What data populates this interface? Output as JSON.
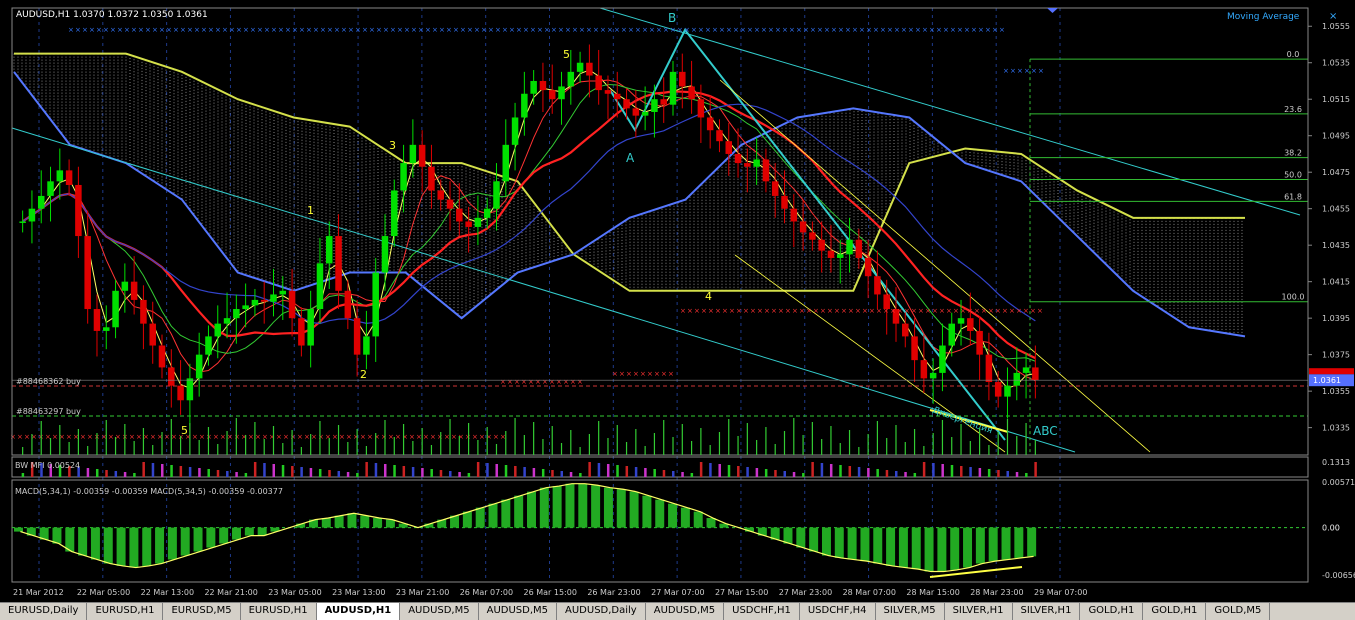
{
  "window": {
    "symbol_header": "AUDUSD,H1  1.0370 1.0372 1.0350 1.0361",
    "indicator_label": "Moving Average",
    "close_glyph": "×"
  },
  "colors": {
    "background": "#000000",
    "grid": "#1e3a8a",
    "bull": "#00e000",
    "bear": "#e00000",
    "cloud_top": "#d4e04a",
    "cloud_bottom": "#5577ff",
    "channel": "#33cccc",
    "price_marker": "#5570ff",
    "fib": "#33bb33"
  },
  "chart_data": {
    "type": "candlestick",
    "title": "AUDUSD,H1",
    "ohlc_header": {
      "open": 1.037,
      "high": 1.0372,
      "low": 1.035,
      "close": 1.0361
    },
    "ylim": [
      1.032,
      1.0565
    ],
    "y_ticks": [
      "1.0555",
      "1.0535",
      "1.0515",
      "1.0495",
      "1.0475",
      "1.0455",
      "1.0435",
      "1.0415",
      "1.0395",
      "1.0375",
      "1.0355",
      "1.0335"
    ],
    "current_price": "1.0361",
    "x_ticks": [
      "21 Mar 2012",
      "22 Mar 05:00",
      "22 Mar 13:00",
      "22 Mar 21:00",
      "23 Mar 05:00",
      "23 Mar 13:00",
      "23 Mar 21:00",
      "26 Mar 07:00",
      "26 Mar 15:00",
      "26 Mar 23:00",
      "27 Mar 07:00",
      "27 Mar 15:00",
      "27 Mar 23:00",
      "28 Mar 07:00",
      "28 Mar 15:00",
      "28 Mar 23:00",
      "29 Mar 07:00"
    ],
    "close_path": [
      1.0448,
      1.0455,
      1.0462,
      1.047,
      1.0476,
      1.0468,
      1.044,
      1.04,
      1.0388,
      1.039,
      1.041,
      1.0415,
      1.0405,
      1.0392,
      1.038,
      1.0368,
      1.0358,
      1.035,
      1.0362,
      1.0375,
      1.0385,
      1.0392,
      1.0395,
      1.04,
      1.0402,
      1.0405,
      1.0404,
      1.0408,
      1.041,
      1.0395,
      1.038,
      1.04,
      1.0425,
      1.044,
      1.041,
      1.0395,
      1.0375,
      1.0385,
      1.042,
      1.044,
      1.0465,
      1.048,
      1.049,
      1.0478,
      1.0465,
      1.046,
      1.0455,
      1.0448,
      1.0445,
      1.045,
      1.0455,
      1.047,
      1.049,
      1.0505,
      1.0518,
      1.0525,
      1.052,
      1.0515,
      1.0522,
      1.053,
      1.0535,
      1.0528,
      1.052,
      1.0518,
      1.0515,
      1.051,
      1.0506,
      1.0508,
      1.0515,
      1.0512,
      1.053,
      1.0522,
      1.0515,
      1.0505,
      1.0498,
      1.0492,
      1.0485,
      1.048,
      1.0478,
      1.0482,
      1.047,
      1.0462,
      1.0455,
      1.0448,
      1.0442,
      1.0438,
      1.0432,
      1.0428,
      1.043,
      1.0438,
      1.0428,
      1.0418,
      1.0408,
      1.04,
      1.0392,
      1.0385,
      1.0372,
      1.0362,
      1.0365,
      1.038,
      1.0392,
      1.0395,
      1.0388,
      1.0375,
      1.036,
      1.0352,
      1.0358,
      1.0365,
      1.0368,
      1.0361
    ],
    "ichimoku_span_a": [
      1.054,
      1.054,
      1.054,
      1.053,
      1.0515,
      1.0505,
      1.05,
      1.048,
      1.048,
      1.047,
      1.043,
      1.041,
      1.041,
      1.041,
      1.041,
      1.041,
      1.048,
      1.0488,
      1.0485,
      1.0465,
      1.045,
      1.045,
      1.045
    ],
    "ichimoku_span_b": [
      1.053,
      1.049,
      1.048,
      1.046,
      1.042,
      1.041,
      1.042,
      1.042,
      1.0395,
      1.042,
      1.043,
      1.045,
      1.046,
      1.049,
      1.0505,
      1.051,
      1.0505,
      1.048,
      1.047,
      1.044,
      1.041,
      1.039,
      1.0385
    ],
    "annotations": [
      {
        "text": "B",
        "color": "#33cccc"
      },
      {
        "text": "A",
        "color": "#33cccc"
      },
      {
        "text": "5",
        "color": "#ffff33"
      },
      {
        "text": "3",
        "color": "#ffff33"
      },
      {
        "text": "1",
        "color": "#ffff33"
      },
      {
        "text": "2",
        "color": "#ffff33"
      },
      {
        "text": "4",
        "color": "#ffff33"
      },
      {
        "text": "5",
        "color": "#ffff33"
      },
      {
        "text": "ABC",
        "color": "#33cccc"
      },
      {
        "text": "Дивергенция",
        "color": "#33cccc"
      }
    ],
    "fib_levels": [
      {
        "label": "0.0",
        "price": 1.0537
      },
      {
        "label": "23.6",
        "price": 1.0507
      },
      {
        "label": "38.2",
        "price": 1.0483
      },
      {
        "label": "50.0",
        "price": 1.0471
      },
      {
        "label": "61.8",
        "price": 1.0459
      },
      {
        "label": "100.0",
        "price": 1.0404
      }
    ],
    "orders": [
      {
        "label": "#88468362 buy"
      },
      {
        "label": "#88463297 buy"
      }
    ],
    "mfi": {
      "label": "BW MFI 0.00524",
      "axis_value": "0.1313"
    },
    "macd": {
      "label": "MACD(5,34,1) -0.00359 -0.00359  MACD(5,34,5) -0.00359 -0.00377",
      "axis_top": "0.00571",
      "axis_mid": "0.00",
      "axis_mid2": "0.00",
      "axis_bottom": "-0.00656",
      "ylim": [
        -0.00656,
        0.00571
      ],
      "histogram": [
        -0.0005,
        -0.001,
        -0.0015,
        -0.002,
        -0.003,
        -0.0035,
        -0.004,
        -0.0045,
        -0.0048,
        -0.005,
        -0.0048,
        -0.0045,
        -0.004,
        -0.0035,
        -0.003,
        -0.0025,
        -0.002,
        -0.0015,
        -0.001,
        -0.001,
        -0.0005,
        0.0,
        0.0005,
        0.001,
        0.0012,
        0.0015,
        0.0018,
        0.0015,
        0.0012,
        0.001,
        0.0005,
        0.0,
        0.0005,
        0.001,
        0.0015,
        0.002,
        0.0025,
        0.003,
        0.0035,
        0.004,
        0.0045,
        0.005,
        0.0052,
        0.0055,
        0.0055,
        0.0053,
        0.005,
        0.0048,
        0.0045,
        0.004,
        0.0035,
        0.003,
        0.0025,
        0.002,
        0.0012,
        0.0005,
        0.0,
        -0.0005,
        -0.001,
        -0.0015,
        -0.002,
        -0.0025,
        -0.003,
        -0.0035,
        -0.0038,
        -0.004,
        -0.0042,
        -0.0045,
        -0.0048,
        -0.005,
        -0.0052,
        -0.0055,
        -0.0055,
        -0.0053,
        -0.005,
        -0.0045,
        -0.0042,
        -0.004,
        -0.0038,
        -0.0036
      ]
    }
  },
  "tabs": [
    {
      "label": "EURUSD,Daily",
      "active": false
    },
    {
      "label": "EURUSD,H1",
      "active": false
    },
    {
      "label": "EURUSD,M5",
      "active": false
    },
    {
      "label": "EURUSD,H1",
      "active": false
    },
    {
      "label": "AUDUSD,H1",
      "active": true
    },
    {
      "label": "AUDUSD,M5",
      "active": false
    },
    {
      "label": "AUDUSD,M5",
      "active": false
    },
    {
      "label": "AUDUSD,Daily",
      "active": false
    },
    {
      "label": "AUDUSD,M5",
      "active": false
    },
    {
      "label": "USDCHF,H1",
      "active": false
    },
    {
      "label": "USDCHF,H4",
      "active": false
    },
    {
      "label": "SILVER,M5",
      "active": false
    },
    {
      "label": "SILVER,H1",
      "active": false
    },
    {
      "label": "SILVER,H1",
      "active": false
    },
    {
      "label": "GOLD,H1",
      "active": false
    },
    {
      "label": "GOLD,H1",
      "active": false
    },
    {
      "label": "GOLD,M5",
      "active": false
    }
  ]
}
